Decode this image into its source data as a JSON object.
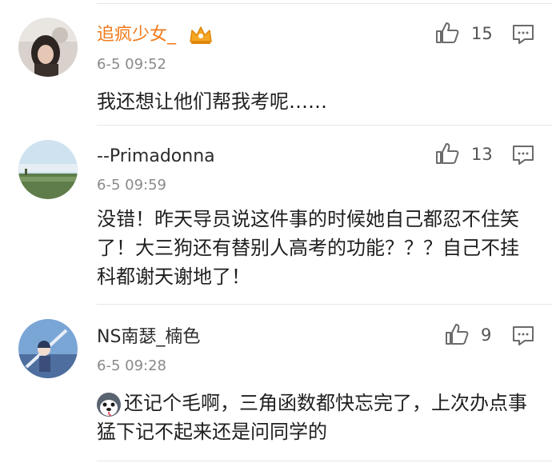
{
  "comments": [
    {
      "user": "追疯少女_",
      "time": "6-5 09:52",
      "likes": "15",
      "text": "我还想让他们帮我考呢……",
      "vip_badge": "crown-icon",
      "name_color": "#f07a1a"
    },
    {
      "user": "--Primadonna",
      "time": "6-5 09:59",
      "likes": "13",
      "text": "没错！昨天导员说这件事的时候她自己都忍不住笑了！大三狗还有替别人高考的功能？？？自己不挂科都谢天谢地了！"
    },
    {
      "user": "NS南瑟_楠色",
      "time": "6-5 09:28",
      "likes": "9",
      "text": "还记个毛啊，三角函数都快忘完了，上次办点事猛下记不起来还是问同学的",
      "leading_emoji": "husky-face-icon"
    }
  ],
  "icons": {
    "like": "thumbs-up-icon",
    "reply": "comment-bubble-icon"
  },
  "colors": {
    "vip_name": "#f07a1a",
    "divider": "#e6e6e6",
    "icon": "#6b6b6b"
  }
}
